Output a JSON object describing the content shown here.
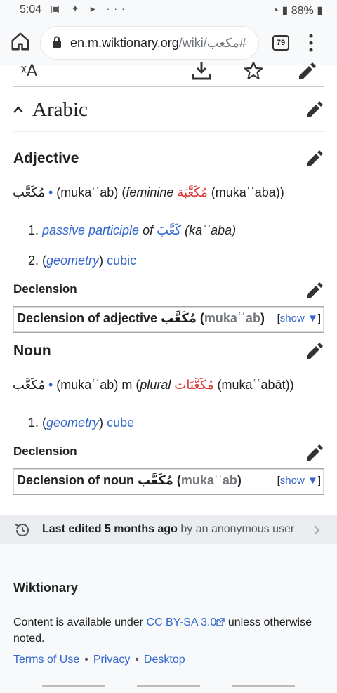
{
  "status_bar": {
    "time": "5:04",
    "battery": "88%"
  },
  "browser": {
    "url_host": "en.m.wiktionary.org",
    "url_path": "/wiki/مكعب#",
    "tab_count": "79"
  },
  "section": {
    "title": "Arabic"
  },
  "adjective": {
    "heading": "Adjective",
    "headword": "مُكَعَّب",
    "bullet": "•",
    "translit": "(mukaʿʿab)",
    "fem_label": "feminine",
    "fem_word": "مُكَعَّبَة",
    "fem_translit": "(mukaʿʿaba))",
    "open_paren": "(",
    "defs": [
      {
        "link": "passive participle",
        "of": "of",
        "ar": "كَعَّبَ",
        "tr": "(kaʿʿaba)"
      },
      {
        "prefix": "(",
        "context": "geometry",
        "suffix": ")",
        "gloss": "cubic"
      }
    ],
    "decl_heading": "Declension",
    "decl_title": "Declension of adjective",
    "decl_ar": "مُكَعَّب",
    "decl_tr": "mukaʿʿab",
    "show": "show"
  },
  "noun": {
    "heading": "Noun",
    "headword": "مُكَعَّب",
    "bullet": "•",
    "translit": "(mukaʿʿab)",
    "gender": "m",
    "plural_label": "plural",
    "plural_word": "مُكَعَّبَات",
    "plural_translit": "(mukaʿʿabāt))",
    "open_paren": "(",
    "defs": [
      {
        "prefix": "(",
        "context": "geometry",
        "suffix": ")",
        "gloss": "cube"
      }
    ],
    "decl_heading": "Declension",
    "decl_title": "Declension of noun",
    "decl_ar": "مُكَعَّب",
    "decl_tr": "mukaʿʿab",
    "show": "show"
  },
  "last_edited": {
    "bold": "Last edited 5 months ago",
    "rest": "by an anonymous user"
  },
  "footer": {
    "brand": "Wiktionary",
    "license_pre": "Content is available under",
    "license_link": "CC BY-SA 3.0",
    "license_post": "unless otherwise noted.",
    "links": [
      "Terms of Use",
      "Privacy",
      "Desktop"
    ],
    "sep": "•"
  },
  "colors": {
    "link": "#3366cc",
    "red_link": "#dd3333",
    "text": "#202122"
  }
}
